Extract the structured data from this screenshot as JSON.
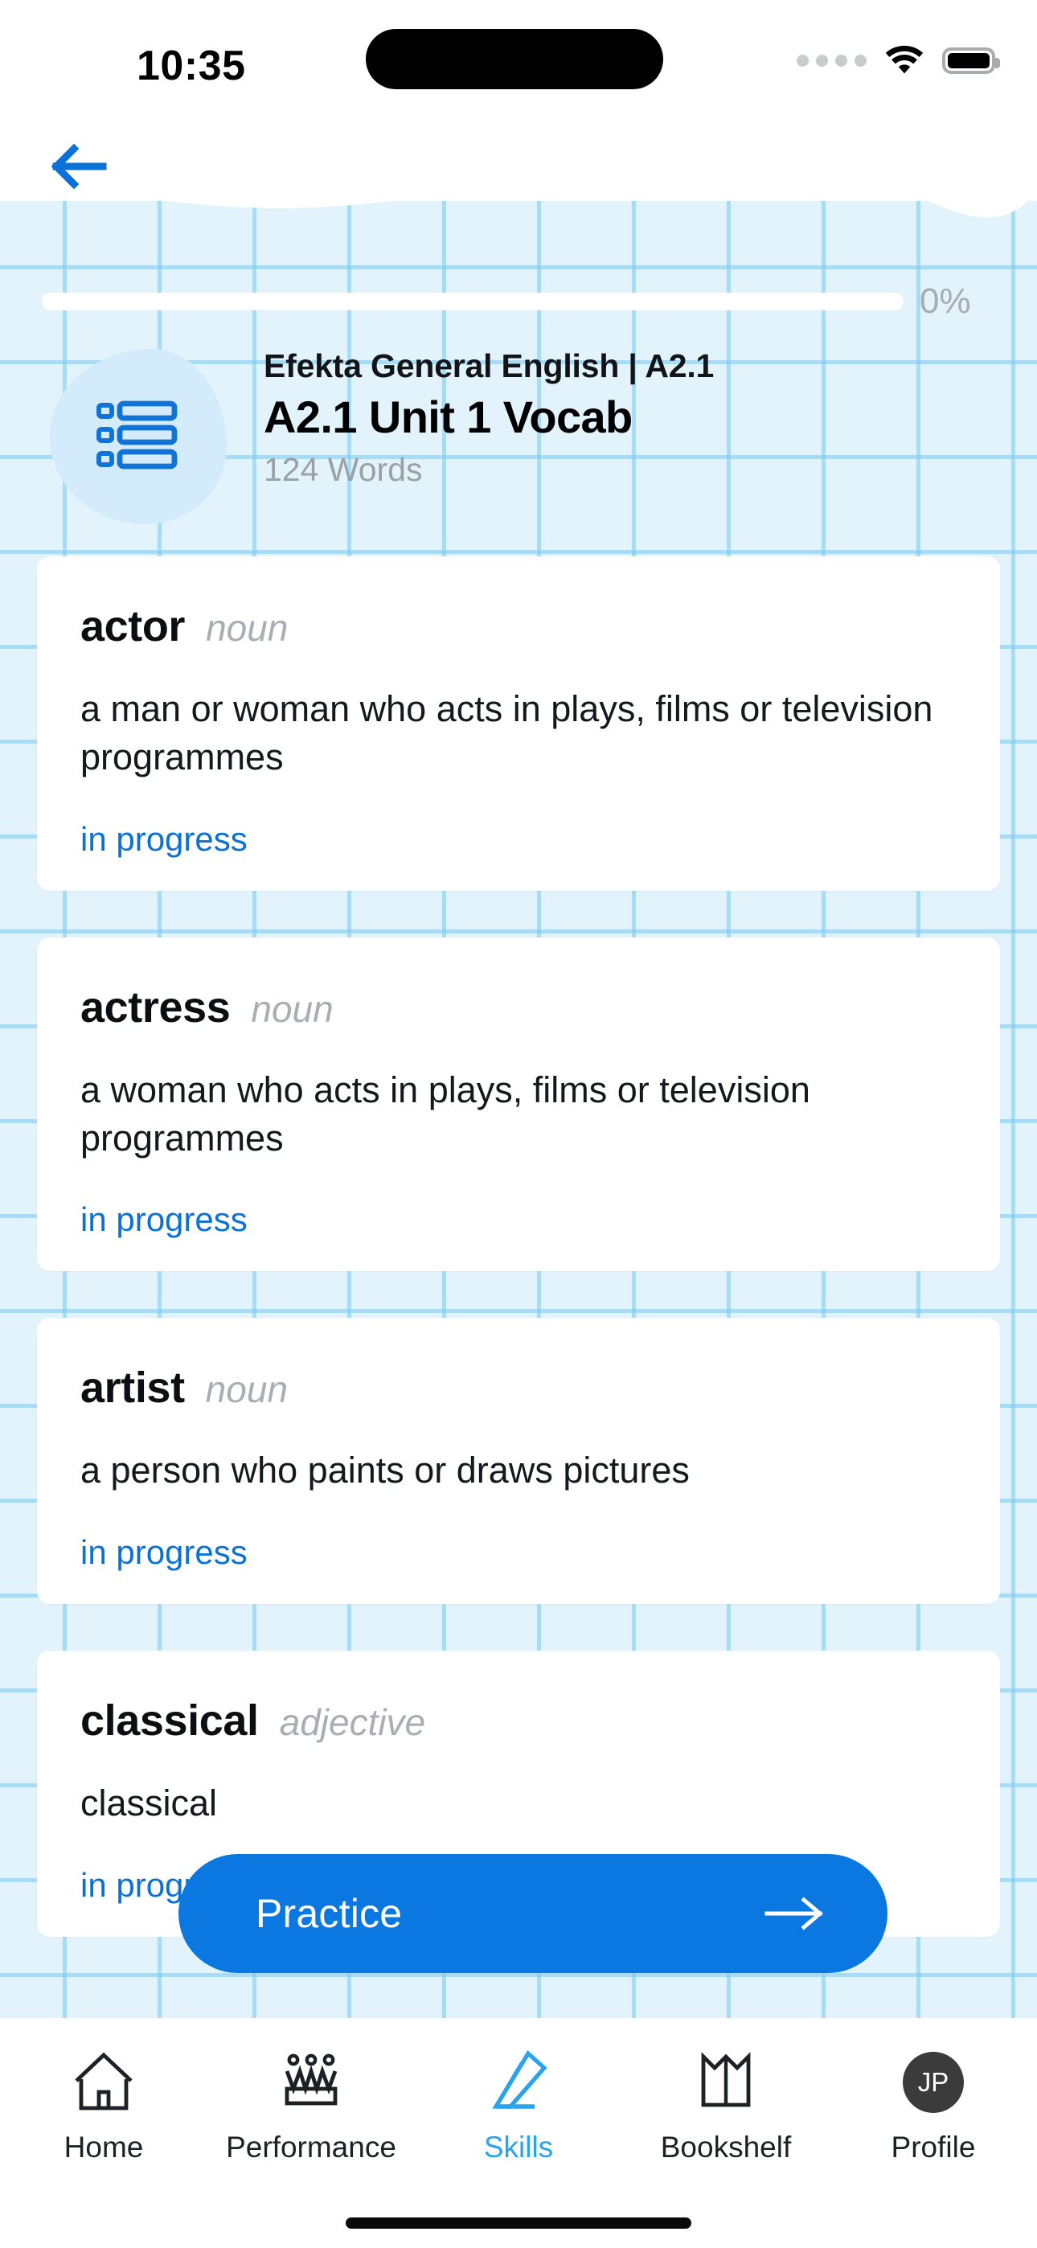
{
  "status_bar": {
    "time": "10:35",
    "signal_icon": "signal-dots-icon",
    "wifi_icon": "wifi-icon",
    "battery_icon": "battery-full-icon"
  },
  "nav_header": {
    "back_icon": "arrow-left-icon"
  },
  "progress": {
    "percent_label": "0%",
    "percent_value": 0
  },
  "course": {
    "icon": "list-icon",
    "breadcrumb": "Efekta General English | A2.1",
    "title": "A2.1 Unit 1 Vocab",
    "word_count": "124 Words"
  },
  "vocab_cards": [
    {
      "word": "actor",
      "part_of_speech": "noun",
      "definition": "a man or woman who acts in plays, films or television programmes",
      "status": "in progress"
    },
    {
      "word": "actress",
      "part_of_speech": "noun",
      "definition": "a woman who acts in plays, films or television programmes",
      "status": "in progress"
    },
    {
      "word": "artist",
      "part_of_speech": "noun",
      "definition": "a person who paints or draws pictures",
      "status": "in progress"
    },
    {
      "word": "classical",
      "part_of_speech": "adjective",
      "definition": "classical",
      "status": "in progress"
    }
  ],
  "practice_button": {
    "label": "Practice",
    "icon": "arrow-right-icon"
  },
  "bottom_nav": {
    "items": [
      {
        "label": "Home",
        "icon": "home-icon",
        "active": false
      },
      {
        "label": "Performance",
        "icon": "crown-icon",
        "active": false
      },
      {
        "label": "Skills",
        "icon": "pencil-icon",
        "active": true
      },
      {
        "label": "Bookshelf",
        "icon": "open-book-icon",
        "active": false
      },
      {
        "label": "Profile",
        "icon": "avatar-icon",
        "initials": "JP",
        "active": false
      }
    ]
  },
  "colors": {
    "accent_blue": "#0a78e0",
    "background_blue": "#e2f3fc",
    "grid_line": "#7dc7ed",
    "active_nav": "#2aa3ef",
    "muted_text": "#a8aeb4"
  }
}
